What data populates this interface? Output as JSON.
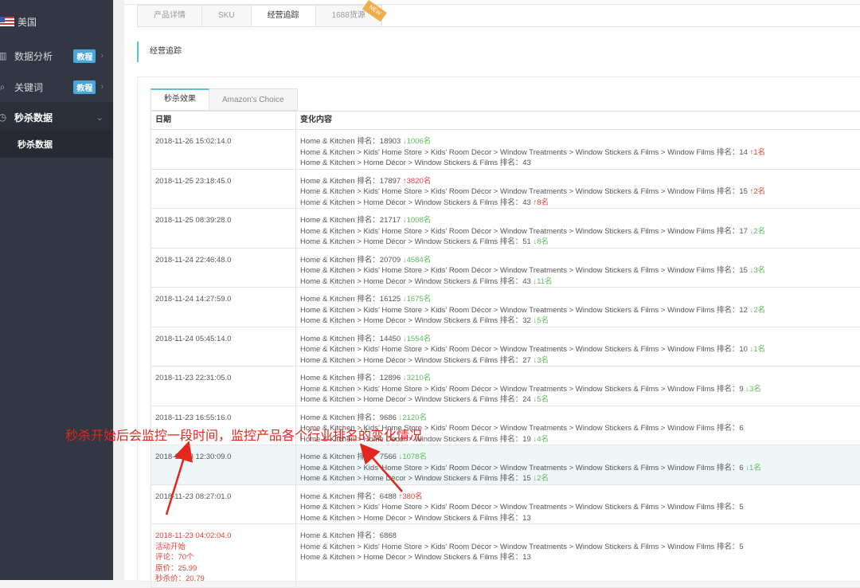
{
  "sidebar": {
    "country": "美国",
    "items": [
      {
        "label": "数据分析",
        "badge": "教程"
      },
      {
        "label": "关键词",
        "badge": "教程"
      },
      {
        "label": "秒杀数据"
      }
    ],
    "sub_item": "秒杀数据"
  },
  "tabs": [
    {
      "label": "产品详情"
    },
    {
      "label": "SKU"
    },
    {
      "label": "经营追踪"
    },
    {
      "label": "1688货源",
      "badge": "NEW"
    }
  ],
  "section_title": "经营追踪",
  "subtabs": [
    {
      "label": "秒杀效果"
    },
    {
      "label": "Amazon's Choice"
    }
  ],
  "table": {
    "headers": [
      "日期",
      "变化内容"
    ],
    "rows": [
      {
        "date": "2018-11-26 15:02:14.0",
        "lines": [
          {
            "text": "Home & Kitchen 排名：18903",
            "change": "1006名",
            "dir": "down"
          },
          {
            "text": "Home & Kitchen > Kids' Home Store > Kids' Room Décor > Window Treatments > Window Stickers & Films > Window Films 排名：14",
            "change": "1名",
            "dir": "up"
          },
          {
            "text": "Home & Kitchen > Home Décor > Window Stickers & Films 排名：43"
          }
        ]
      },
      {
        "date": "2018-11-25 23:18:45.0",
        "lines": [
          {
            "text": "Home & Kitchen 排名：17897",
            "change": "3820名",
            "dir": "up"
          },
          {
            "text": "Home & Kitchen > Kids' Home Store > Kids' Room Décor > Window Treatments > Window Stickers & Films > Window Films 排名：15",
            "change": "2名",
            "dir": "up"
          },
          {
            "text": "Home & Kitchen > Home Décor > Window Stickers & Films 排名：43",
            "change": "8名",
            "dir": "up"
          }
        ]
      },
      {
        "date": "2018-11-25 08:39:28.0",
        "lines": [
          {
            "text": "Home & Kitchen 排名：21717",
            "change": "1008名",
            "dir": "down"
          },
          {
            "text": "Home & Kitchen > Kids' Home Store > Kids' Room Décor > Window Treatments > Window Stickers & Films > Window Films 排名：17",
            "change": "2名",
            "dir": "down"
          },
          {
            "text": "Home & Kitchen > Home Décor > Window Stickers & Films 排名：51",
            "change": "8名",
            "dir": "down"
          }
        ]
      },
      {
        "date": "2018-11-24 22:46:48.0",
        "lines": [
          {
            "text": "Home & Kitchen 排名：20709",
            "change": "4584名",
            "dir": "down"
          },
          {
            "text": "Home & Kitchen > Kids' Home Store > Kids' Room Décor > Window Treatments > Window Stickers & Films > Window Films 排名：15",
            "change": "3名",
            "dir": "down"
          },
          {
            "text": "Home & Kitchen > Home Décor > Window Stickers & Films 排名：43",
            "change": "11名",
            "dir": "down"
          }
        ]
      },
      {
        "date": "2018-11-24 14:27:59.0",
        "lines": [
          {
            "text": "Home & Kitchen 排名：16125",
            "change": "1675名",
            "dir": "down"
          },
          {
            "text": "Home & Kitchen > Kids' Home Store > Kids' Room Décor > Window Treatments > Window Stickers & Films > Window Films 排名：12",
            "change": "2名",
            "dir": "down"
          },
          {
            "text": "Home & Kitchen > Home Décor > Window Stickers & Films 排名：32",
            "change": "5名",
            "dir": "down"
          }
        ]
      },
      {
        "date": "2018-11-24 05:45:14.0",
        "lines": [
          {
            "text": "Home & Kitchen 排名：14450",
            "change": "1554名",
            "dir": "down"
          },
          {
            "text": "Home & Kitchen > Kids' Home Store > Kids' Room Décor > Window Treatments > Window Stickers & Films > Window Films 排名：10",
            "change": "1名",
            "dir": "down"
          },
          {
            "text": "Home & Kitchen > Home Décor > Window Stickers & Films 排名：27",
            "change": "3名",
            "dir": "down"
          }
        ]
      },
      {
        "date": "2018-11-23 22:31:05.0",
        "lines": [
          {
            "text": "Home & Kitchen 排名：12896",
            "change": "3210名",
            "dir": "down"
          },
          {
            "text": "Home & Kitchen > Kids' Home Store > Kids' Room Décor > Window Treatments > Window Stickers & Films > Window Films 排名：9",
            "change": "3名",
            "dir": "down"
          },
          {
            "text": "Home & Kitchen > Home Décor > Window Stickers & Films 排名：24",
            "change": "5名",
            "dir": "down"
          }
        ]
      },
      {
        "date": "2018-11-23 16:55:16.0",
        "lines": [
          {
            "text": "Home & Kitchen 排名：9686",
            "change": "2120名",
            "dir": "down"
          },
          {
            "text": "Home & Kitchen > Kids' Home Store > Kids' Room Décor > Window Treatments > Window Stickers & Films > Window Films 排名：6"
          },
          {
            "text": "Home & Kitchen > Home Décor > Window Stickers & Films 排名：19",
            "change": "4名",
            "dir": "down"
          }
        ]
      },
      {
        "date": "2018-11-23 12:30:09.0",
        "highlight": true,
        "lines": [
          {
            "text": "Home & Kitchen 排名：7566",
            "change": "1078名",
            "dir": "down"
          },
          {
            "text": "Home & Kitchen > Kids' Home Store > Kids' Room Décor > Window Treatments > Window Stickers & Films > Window Films 排名：6",
            "change": "1名",
            "dir": "down"
          },
          {
            "text": "Home & Kitchen > Home Décor > Window Stickers & Films 排名：15",
            "change": "2名",
            "dir": "down"
          }
        ]
      },
      {
        "date": "2018-11-23 08:27:01.0",
        "lines": [
          {
            "text": "Home & Kitchen 排名：6488",
            "change": "380名",
            "dir": "up"
          },
          {
            "text": "Home & Kitchen > Kids' Home Store > Kids' Room Décor > Window Treatments > Window Stickers & Films > Window Films 排名：5"
          },
          {
            "text": "Home & Kitchen > Home Décor > Window Stickers & Films 排名：13"
          }
        ]
      },
      {
        "date": "2018-11-23 04:02:04.0",
        "date_warn": true,
        "date_notes": [
          "活动开始",
          "评论：70个",
          "原价：25.99",
          "秒杀价：20.79"
        ],
        "lines": [
          {
            "text": "Home & Kitchen 排名：6868"
          },
          {
            "text": "Home & Kitchen > Kids' Home Store > Kids' Room Décor > Window Treatments > Window Stickers & Films > Window Films 排名：5"
          },
          {
            "text": "Home & Kitchen > Home Décor > Window Stickers & Films 排名：13"
          }
        ]
      }
    ]
  },
  "annotation": "秒杀开始后会监控一段时间，监控产品各个行业排名的变化情况",
  "colors": {
    "up": "#e0413a",
    "down": "#5cb85c",
    "accent": "#5bc0de",
    "sidebar": "#333744"
  }
}
